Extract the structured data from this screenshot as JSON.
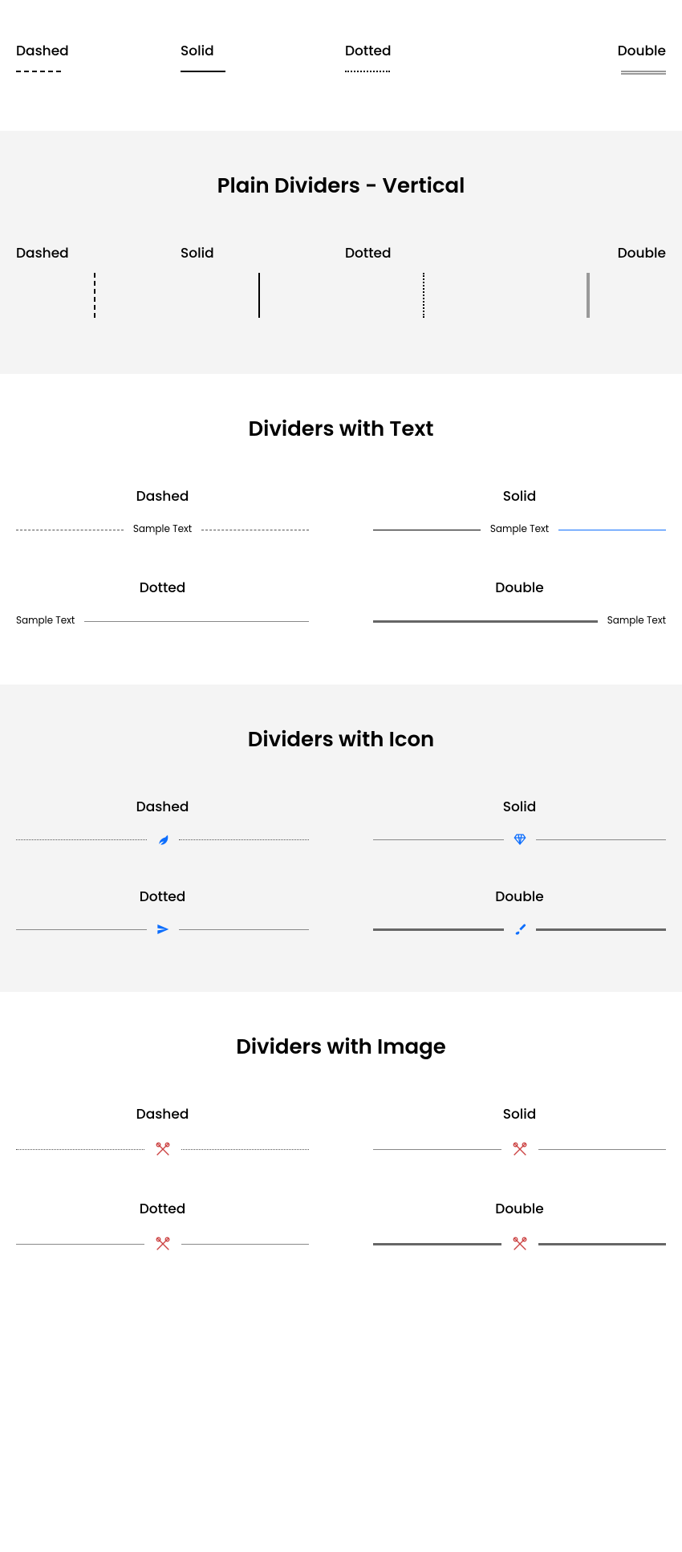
{
  "labels": {
    "dashed": "Dashed",
    "solid": "Solid",
    "dotted": "Dotted",
    "double": "Double"
  },
  "sections": {
    "vertical": "Plain Dividers - Vertical",
    "text": "Dividers with Text",
    "icon": "Dividers with Icon",
    "image": "Dividers with Image"
  },
  "sample": "Sample Text",
  "icons": {
    "leaf": "leaf-icon",
    "gem": "gem-icon",
    "plane": "paper-plane-icon",
    "brush": "brush-icon",
    "utensils": "crossed-utensils-icon"
  },
  "colors": {
    "accent": "#0d6efd",
    "image_icon": "#c44",
    "double_gray": "#999"
  }
}
